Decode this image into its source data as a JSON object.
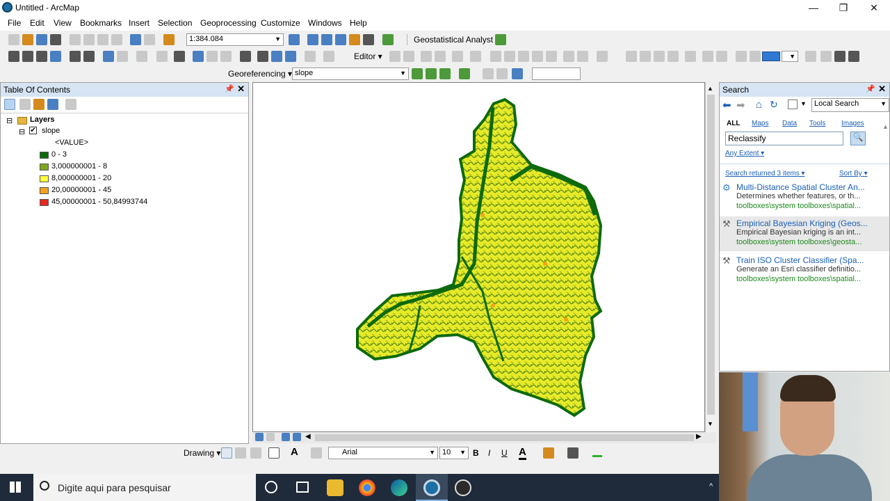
{
  "window": {
    "title": "Untitled - ArcMap"
  },
  "menu": [
    "File",
    "Edit",
    "View",
    "Bookmarks",
    "Insert",
    "Selection",
    "Geoprocessing",
    "Customize",
    "Windows",
    "Help"
  ],
  "toolbar": {
    "scale": "1:384.084",
    "geostat_label": "Geostatistical Analyst ▾",
    "editor_label": "Editor ▾",
    "georef_label": "Georeferencing ▾",
    "georef_layer": "slope"
  },
  "toc": {
    "title": "Table Of Contents",
    "layers_label": "Layers",
    "layer_name": "slope",
    "value_label": "<VALUE>",
    "legend": [
      {
        "label": "0 - 3",
        "color": "#0d6a0d"
      },
      {
        "label": "3,000000001 - 8",
        "color": "#7fa81c"
      },
      {
        "label": "8,000000001 - 20",
        "color": "#ffff3a"
      },
      {
        "label": "20,00000001 - 45",
        "color": "#f3a31d"
      },
      {
        "label": "45,00000001 - 50,84993744",
        "color": "#e8271d"
      }
    ]
  },
  "drawing": {
    "label": "Drawing ▾",
    "font": "Arial",
    "size": "10"
  },
  "search": {
    "title": "Search",
    "scope": "Local Search",
    "tabs": [
      "ALL",
      "Maps",
      "Data",
      "Tools",
      "Images"
    ],
    "query": "Reclassify",
    "extent": "Any Extent ▾",
    "count_label": "Search returned 3 items ▾",
    "sort_label": "Sort By ▾",
    "results": [
      {
        "title": "Multi-Distance Spatial Cluster An...",
        "desc": "Determines whether features, or th...",
        "path": "toolboxes\\system toolboxes\\spatial..."
      },
      {
        "title": "Empirical Bayesian Kriging (Geos...",
        "desc": "Empirical Bayesian kriging is an int...",
        "path": "toolboxes\\system toolboxes\\geosta..."
      },
      {
        "title": "Train ISO Cluster Classifier (Spa...",
        "desc": "Generate an Esri classifier definitio...",
        "path": "toolboxes\\system toolboxes\\spatial..."
      }
    ]
  },
  "taskbar": {
    "search_placeholder": "Digite aqui para pesquisar"
  }
}
